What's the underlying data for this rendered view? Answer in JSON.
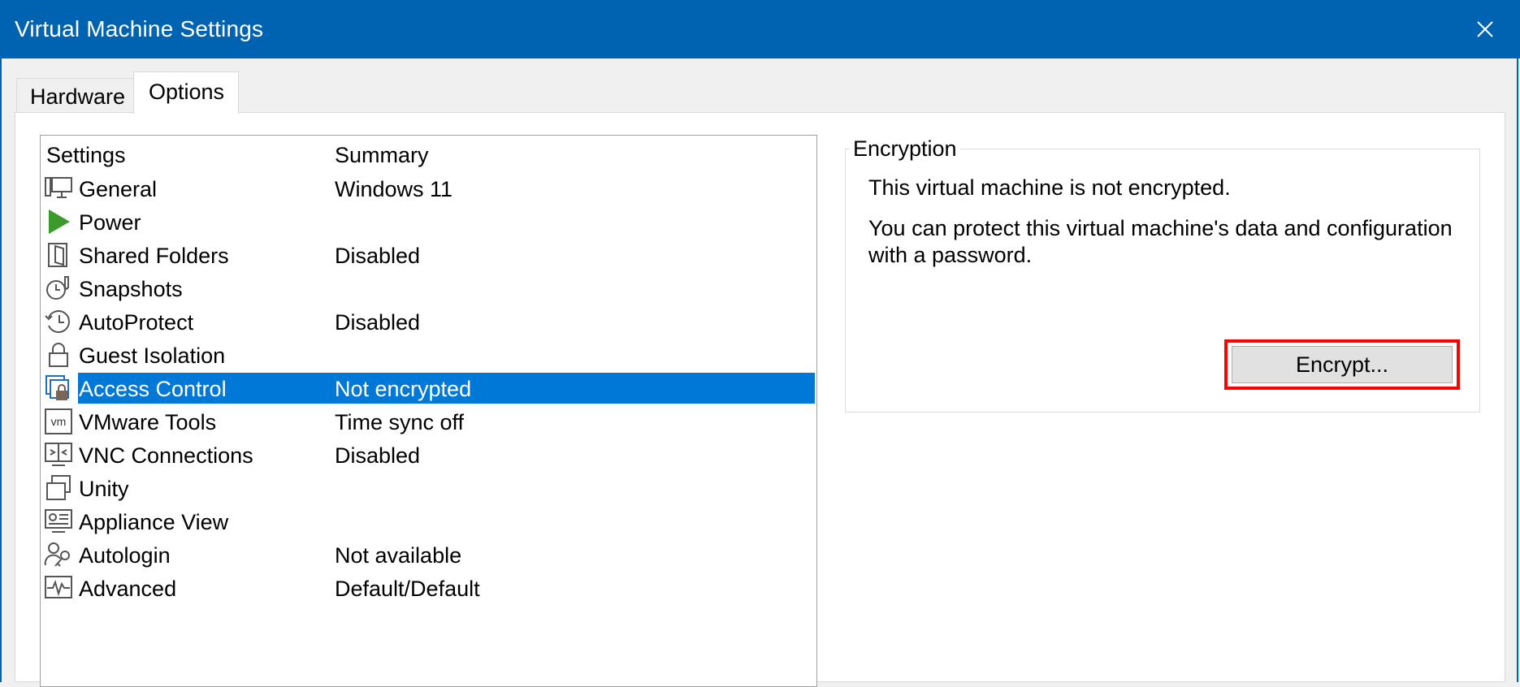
{
  "window": {
    "title": "Virtual Machine Settings",
    "close_icon": "close-icon",
    "accent_color": "#0063b1"
  },
  "tabs": [
    {
      "label": "Hardware",
      "active": false
    },
    {
      "label": "Options",
      "active": true
    }
  ],
  "settings_list": {
    "columns": [
      "Settings",
      "Summary"
    ],
    "selection_color": "#0078d7",
    "rows": [
      {
        "label": "General",
        "summary": "Windows 11",
        "icon": "monitor-icon"
      },
      {
        "label": "Power",
        "summary": "",
        "icon": "power-play-icon"
      },
      {
        "label": "Shared Folders",
        "summary": "Disabled",
        "icon": "shared-folder-icon"
      },
      {
        "label": "Snapshots",
        "summary": "",
        "icon": "snapshot-icon"
      },
      {
        "label": "AutoProtect",
        "summary": "Disabled",
        "icon": "autoprotect-clock-icon"
      },
      {
        "label": "Guest Isolation",
        "summary": "",
        "icon": "lock-icon"
      },
      {
        "label": "Access Control",
        "summary": "Not encrypted",
        "icon": "access-control-icon",
        "selected": true
      },
      {
        "label": "VMware Tools",
        "summary": "Time sync off",
        "icon": "vmware-tools-icon"
      },
      {
        "label": "VNC Connections",
        "summary": "Disabled",
        "icon": "vnc-icon"
      },
      {
        "label": "Unity",
        "summary": "",
        "icon": "unity-icon"
      },
      {
        "label": "Appliance View",
        "summary": "",
        "icon": "appliance-view-icon"
      },
      {
        "label": "Autologin",
        "summary": "Not available",
        "icon": "autologin-key-icon"
      },
      {
        "label": "Advanced",
        "summary": "Default/Default",
        "icon": "advanced-pulse-icon"
      }
    ]
  },
  "encryption": {
    "group_title": "Encryption",
    "status_text": "This virtual machine is not encrypted.",
    "description": "You can protect this virtual machine's data and configuration with a password.",
    "encrypt_button": "Encrypt..."
  }
}
